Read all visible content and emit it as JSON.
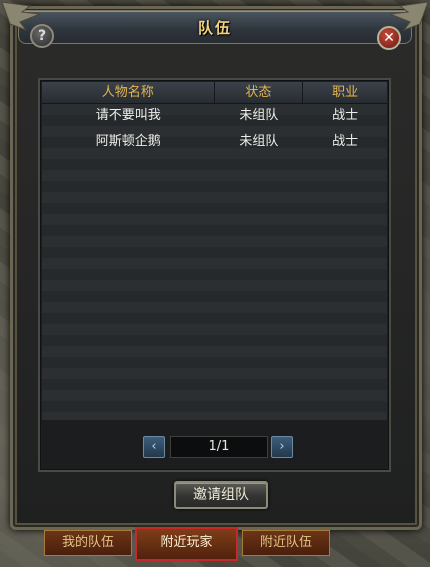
{
  "window": {
    "title": "队伍",
    "help_glyph": "?",
    "close_glyph": "✕"
  },
  "table": {
    "headers": [
      "人物名称",
      "状态",
      "职业"
    ],
    "rows": [
      [
        "请不要叫我",
        "未组队",
        "战士"
      ],
      [
        "阿斯顿企鹅",
        "未组队",
        "战士"
      ]
    ]
  },
  "pager": {
    "text": "1/1",
    "prev_glyph": "‹",
    "next_glyph": "›"
  },
  "actions": {
    "invite_label": "邀请组队"
  },
  "tabs": [
    {
      "label": "我的队伍",
      "selected": false
    },
    {
      "label": "附近玩家",
      "selected": true
    },
    {
      "label": "附近队伍",
      "selected": false
    }
  ],
  "colors": {
    "header_text": "#e5b550",
    "title_text": "#f2d27a",
    "selected_tab_border": "#c42a2a"
  }
}
